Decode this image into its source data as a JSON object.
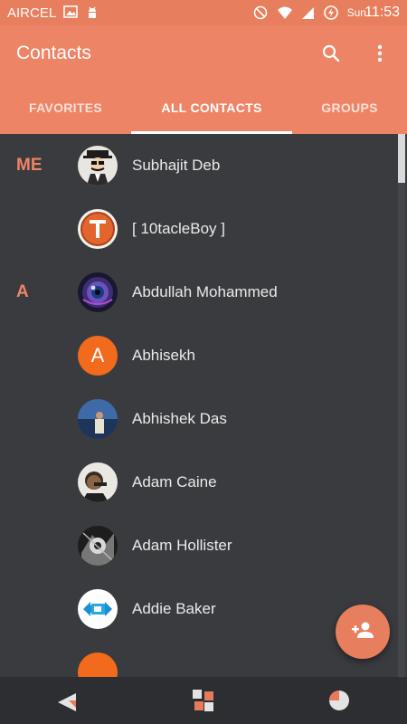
{
  "status_bar": {
    "carrier": "AIRCEL",
    "day": "Sun",
    "time": "11:53",
    "icons": [
      "image-icon",
      "android-debug-icon",
      "do-not-disturb-icon",
      "wifi-icon",
      "signal-icon",
      "battery-charging-icon"
    ]
  },
  "toolbar": {
    "title": "Contacts",
    "actions": [
      "search-icon",
      "more-vert-icon"
    ]
  },
  "tabs": [
    {
      "label": "FAVORITES",
      "active": false
    },
    {
      "label": "ALL CONTACTS",
      "active": true
    },
    {
      "label": "GROUPS",
      "active": false
    }
  ],
  "contacts": [
    {
      "section": "ME",
      "name": "Subhajit Deb",
      "avatar": "cartoon-avatar-icon"
    },
    {
      "section": "",
      "name": "[ 10tacleBoy ]",
      "avatar": "letter-t-logo-avatar"
    },
    {
      "section": "A",
      "name": "Abdullah Mohammed",
      "avatar": "lens-photo-avatar"
    },
    {
      "section": "",
      "name": "Abhisekh",
      "avatar": "letter-avatar",
      "initial": "A"
    },
    {
      "section": "",
      "name": "Abhishek Das",
      "avatar": "outdoor-photo-avatar"
    },
    {
      "section": "",
      "name": "Adam Caine",
      "avatar": "portrait-photo-avatar"
    },
    {
      "section": "",
      "name": "Adam Hollister",
      "avatar": "monochrome-photo-avatar"
    },
    {
      "section": "",
      "name": "Addie Baker",
      "avatar": "dx-logo-avatar"
    },
    {
      "section": "",
      "name": "",
      "avatar": "letter-avatar",
      "initial": ""
    }
  ],
  "fab": {
    "icon": "add-person-icon"
  },
  "nav_bar": [
    "back-icon",
    "home-icon",
    "recents-icon"
  ],
  "colors": {
    "primary": "#ee8466",
    "primary_dark": "#e77e5d",
    "background": "#3a3b3f",
    "accent_letter_avatar": "#f26a1b"
  }
}
